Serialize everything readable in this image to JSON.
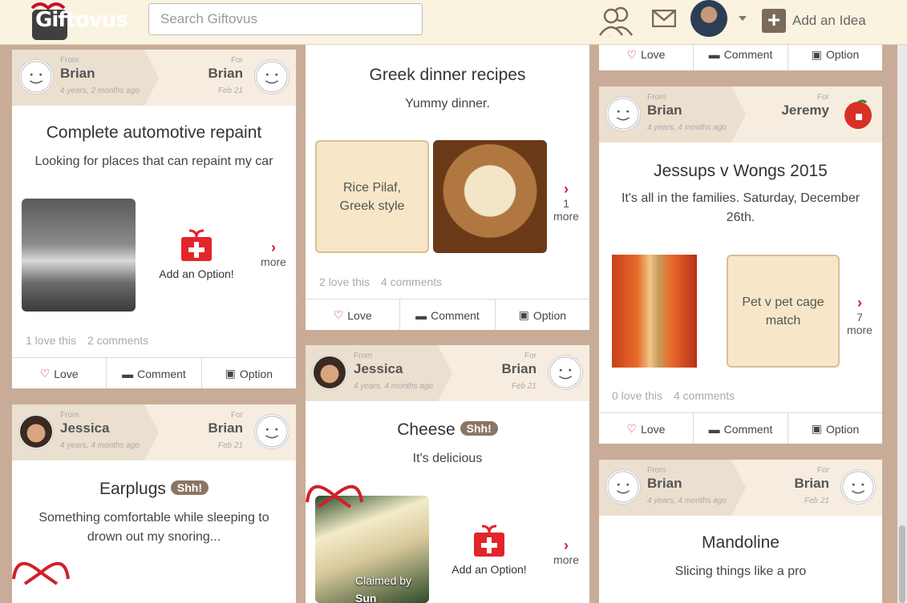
{
  "header": {
    "logo_text": "Giftovus",
    "search_placeholder": "Search Giftovus",
    "add_idea_label": "Add an Idea"
  },
  "cards": [
    {
      "id": "repaint",
      "from_label": "From",
      "from_name": "Brian",
      "from_time": "4 years, 2 months ago",
      "for_label": "For",
      "for_name": "Brian",
      "for_date": "Feb 21",
      "title": "Complete automotive repaint",
      "description": "Looking for places that can repaint my car",
      "add_option_label": "Add an Option!",
      "more_label": "more",
      "loves": "1 love this",
      "comments": "2 comments"
    },
    {
      "id": "earplugs",
      "from_label": "From",
      "from_name": "Jessica",
      "from_time": "4 years, 4 months ago",
      "for_label": "For",
      "for_name": "Brian",
      "for_date": "Feb 21",
      "title": "Earplugs",
      "badge": "Shh!",
      "description": "Something comfortable while sleeping to drown out my snoring..."
    },
    {
      "id": "greek",
      "title": "Greek dinner recipes",
      "description": "Yummy dinner.",
      "option_text": "Rice Pilaf, Greek style",
      "more_count": "1",
      "more_label": "more",
      "loves": "2 love this",
      "comments": "4 comments"
    },
    {
      "id": "cheese",
      "from_label": "From",
      "from_name": "Jessica",
      "from_time": "4 years, 4 months ago",
      "for_label": "For",
      "for_name": "Brian",
      "for_date": "Feb 21",
      "title": "Cheese",
      "badge": "Shh!",
      "description": "It's delicious",
      "claimed_label": "Claimed by",
      "claimed_name": "Sun",
      "add_option_label": "Add an Option!",
      "more_label": "more"
    },
    {
      "id": "jessups",
      "from_label": "From",
      "from_name": "Brian",
      "from_time": "4 years, 4 months ago",
      "for_label": "For",
      "for_name": "Jeremy",
      "title": "Jessups v Wongs 2015",
      "description": "It's all in the families. Saturday, December 26th.",
      "option_text": "Pet v pet cage match",
      "more_count": "7",
      "more_label": "more",
      "loves": "0 love this",
      "comments": "4 comments"
    },
    {
      "id": "mandoline",
      "from_label": "From",
      "from_name": "Brian",
      "from_time": "4 years, 4 months ago",
      "for_label": "For",
      "for_name": "Brian",
      "for_date": "Feb 21",
      "title": "Mandoline",
      "description": "Slicing things like a pro"
    }
  ],
  "actions": {
    "love": "Love",
    "comment": "Comment",
    "option": "Option"
  },
  "colors": {
    "accent_red": "#c8102e",
    "bg": "#c8ac98",
    "header_bg": "#faf3df",
    "badge": "#8a7664"
  }
}
